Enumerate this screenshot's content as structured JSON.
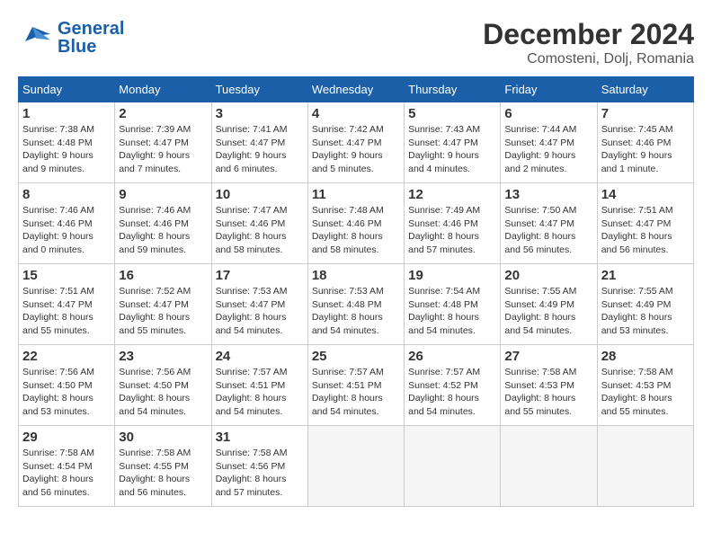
{
  "header": {
    "logo_line1": "General",
    "logo_line2": "Blue",
    "month": "December 2024",
    "location": "Comosteni, Dolj, Romania"
  },
  "weekdays": [
    "Sunday",
    "Monday",
    "Tuesday",
    "Wednesday",
    "Thursday",
    "Friday",
    "Saturday"
  ],
  "weeks": [
    [
      {
        "day": "1",
        "sunrise": "Sunrise: 7:38 AM",
        "sunset": "Sunset: 4:48 PM",
        "daylight": "Daylight: 9 hours and 9 minutes."
      },
      {
        "day": "2",
        "sunrise": "Sunrise: 7:39 AM",
        "sunset": "Sunset: 4:47 PM",
        "daylight": "Daylight: 9 hours and 7 minutes."
      },
      {
        "day": "3",
        "sunrise": "Sunrise: 7:41 AM",
        "sunset": "Sunset: 4:47 PM",
        "daylight": "Daylight: 9 hours and 6 minutes."
      },
      {
        "day": "4",
        "sunrise": "Sunrise: 7:42 AM",
        "sunset": "Sunset: 4:47 PM",
        "daylight": "Daylight: 9 hours and 5 minutes."
      },
      {
        "day": "5",
        "sunrise": "Sunrise: 7:43 AM",
        "sunset": "Sunset: 4:47 PM",
        "daylight": "Daylight: 9 hours and 4 minutes."
      },
      {
        "day": "6",
        "sunrise": "Sunrise: 7:44 AM",
        "sunset": "Sunset: 4:47 PM",
        "daylight": "Daylight: 9 hours and 2 minutes."
      },
      {
        "day": "7",
        "sunrise": "Sunrise: 7:45 AM",
        "sunset": "Sunset: 4:46 PM",
        "daylight": "Daylight: 9 hours and 1 minute."
      }
    ],
    [
      {
        "day": "8",
        "sunrise": "Sunrise: 7:46 AM",
        "sunset": "Sunset: 4:46 PM",
        "daylight": "Daylight: 9 hours and 0 minutes."
      },
      {
        "day": "9",
        "sunrise": "Sunrise: 7:46 AM",
        "sunset": "Sunset: 4:46 PM",
        "daylight": "Daylight: 8 hours and 59 minutes."
      },
      {
        "day": "10",
        "sunrise": "Sunrise: 7:47 AM",
        "sunset": "Sunset: 4:46 PM",
        "daylight": "Daylight: 8 hours and 58 minutes."
      },
      {
        "day": "11",
        "sunrise": "Sunrise: 7:48 AM",
        "sunset": "Sunset: 4:46 PM",
        "daylight": "Daylight: 8 hours and 58 minutes."
      },
      {
        "day": "12",
        "sunrise": "Sunrise: 7:49 AM",
        "sunset": "Sunset: 4:46 PM",
        "daylight": "Daylight: 8 hours and 57 minutes."
      },
      {
        "day": "13",
        "sunrise": "Sunrise: 7:50 AM",
        "sunset": "Sunset: 4:47 PM",
        "daylight": "Daylight: 8 hours and 56 minutes."
      },
      {
        "day": "14",
        "sunrise": "Sunrise: 7:51 AM",
        "sunset": "Sunset: 4:47 PM",
        "daylight": "Daylight: 8 hours and 56 minutes."
      }
    ],
    [
      {
        "day": "15",
        "sunrise": "Sunrise: 7:51 AM",
        "sunset": "Sunset: 4:47 PM",
        "daylight": "Daylight: 8 hours and 55 minutes."
      },
      {
        "day": "16",
        "sunrise": "Sunrise: 7:52 AM",
        "sunset": "Sunset: 4:47 PM",
        "daylight": "Daylight: 8 hours and 55 minutes."
      },
      {
        "day": "17",
        "sunrise": "Sunrise: 7:53 AM",
        "sunset": "Sunset: 4:47 PM",
        "daylight": "Daylight: 8 hours and 54 minutes."
      },
      {
        "day": "18",
        "sunrise": "Sunrise: 7:53 AM",
        "sunset": "Sunset: 4:48 PM",
        "daylight": "Daylight: 8 hours and 54 minutes."
      },
      {
        "day": "19",
        "sunrise": "Sunrise: 7:54 AM",
        "sunset": "Sunset: 4:48 PM",
        "daylight": "Daylight: 8 hours and 54 minutes."
      },
      {
        "day": "20",
        "sunrise": "Sunrise: 7:55 AM",
        "sunset": "Sunset: 4:49 PM",
        "daylight": "Daylight: 8 hours and 54 minutes."
      },
      {
        "day": "21",
        "sunrise": "Sunrise: 7:55 AM",
        "sunset": "Sunset: 4:49 PM",
        "daylight": "Daylight: 8 hours and 53 minutes."
      }
    ],
    [
      {
        "day": "22",
        "sunrise": "Sunrise: 7:56 AM",
        "sunset": "Sunset: 4:50 PM",
        "daylight": "Daylight: 8 hours and 53 minutes."
      },
      {
        "day": "23",
        "sunrise": "Sunrise: 7:56 AM",
        "sunset": "Sunset: 4:50 PM",
        "daylight": "Daylight: 8 hours and 54 minutes."
      },
      {
        "day": "24",
        "sunrise": "Sunrise: 7:57 AM",
        "sunset": "Sunset: 4:51 PM",
        "daylight": "Daylight: 8 hours and 54 minutes."
      },
      {
        "day": "25",
        "sunrise": "Sunrise: 7:57 AM",
        "sunset": "Sunset: 4:51 PM",
        "daylight": "Daylight: 8 hours and 54 minutes."
      },
      {
        "day": "26",
        "sunrise": "Sunrise: 7:57 AM",
        "sunset": "Sunset: 4:52 PM",
        "daylight": "Daylight: 8 hours and 54 minutes."
      },
      {
        "day": "27",
        "sunrise": "Sunrise: 7:58 AM",
        "sunset": "Sunset: 4:53 PM",
        "daylight": "Daylight: 8 hours and 55 minutes."
      },
      {
        "day": "28",
        "sunrise": "Sunrise: 7:58 AM",
        "sunset": "Sunset: 4:53 PM",
        "daylight": "Daylight: 8 hours and 55 minutes."
      }
    ],
    [
      {
        "day": "29",
        "sunrise": "Sunrise: 7:58 AM",
        "sunset": "Sunset: 4:54 PM",
        "daylight": "Daylight: 8 hours and 56 minutes."
      },
      {
        "day": "30",
        "sunrise": "Sunrise: 7:58 AM",
        "sunset": "Sunset: 4:55 PM",
        "daylight": "Daylight: 8 hours and 56 minutes."
      },
      {
        "day": "31",
        "sunrise": "Sunrise: 7:58 AM",
        "sunset": "Sunset: 4:56 PM",
        "daylight": "Daylight: 8 hours and 57 minutes."
      },
      null,
      null,
      null,
      null
    ]
  ]
}
